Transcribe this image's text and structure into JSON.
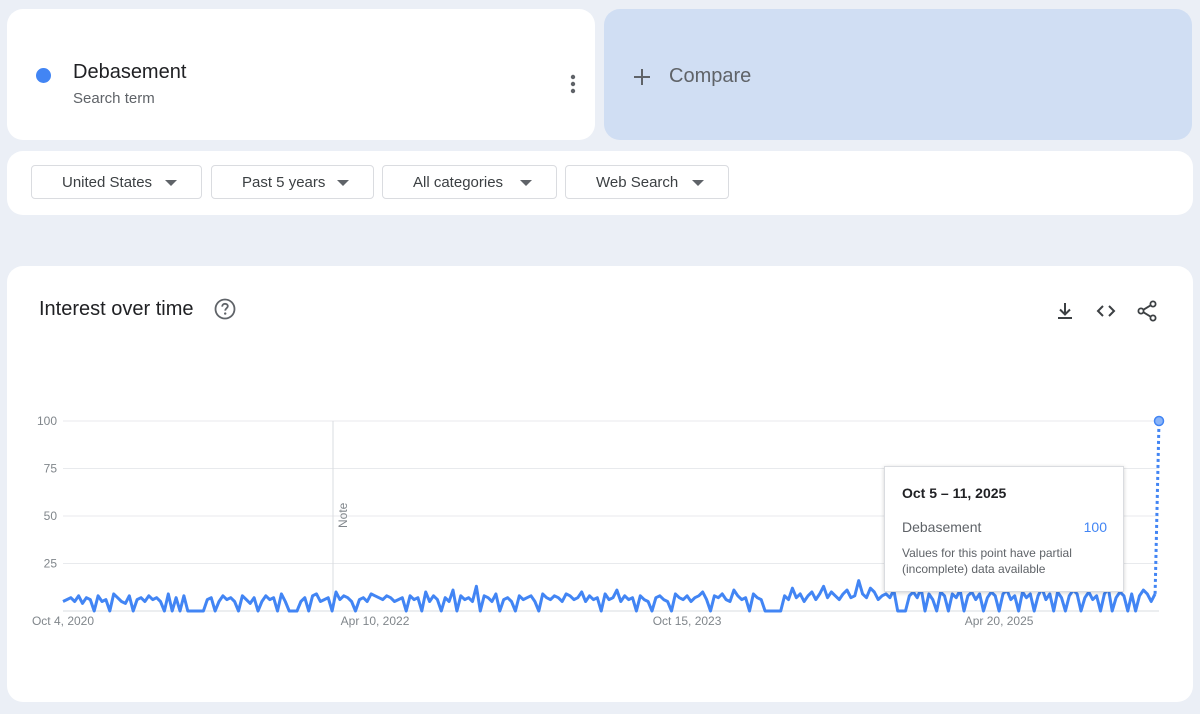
{
  "search_term": {
    "name": "Debasement",
    "subtitle": "Search term",
    "color": "#4285f4",
    "menu_icon": "more-vert-icon"
  },
  "compare": {
    "label": "Compare",
    "icon": "plus-icon"
  },
  "filters": [
    {
      "label": "United States"
    },
    {
      "label": "Past 5 years"
    },
    {
      "label": "All categories"
    },
    {
      "label": "Web Search"
    }
  ],
  "chart_panel": {
    "title": "Interest over time",
    "icons": [
      "help-icon",
      "download-icon",
      "embed-icon",
      "share-icon"
    ],
    "note_label": "Note"
  },
  "tooltip": {
    "date": "Oct 5 – 11, 2025",
    "term": "Debasement",
    "value": "100",
    "note": "Values for this point have partial (incomplete) data available"
  },
  "chart_data": {
    "type": "line",
    "title": "Interest over time",
    "xlabel": "",
    "ylabel": "",
    "ylim": [
      0,
      100
    ],
    "yticks": [
      25,
      50,
      75,
      100
    ],
    "grid": true,
    "xtick_labels": [
      "Oct 4, 2020",
      "Apr 10, 2022",
      "Oct 15, 2023",
      "Apr 20, 2025"
    ],
    "x_range": [
      "Oct 4, 2020",
      "Oct 5, 2025"
    ],
    "last_point_partial": true,
    "series": [
      {
        "name": "Debasement",
        "color": "#4285f4",
        "values": [
          5,
          6,
          7,
          5,
          8,
          4,
          7,
          6,
          0,
          8,
          5,
          6,
          0,
          9,
          7,
          5,
          4,
          8,
          0,
          6,
          7,
          5,
          8,
          6,
          7,
          5,
          0,
          9,
          0,
          7,
          0,
          8,
          0,
          0,
          0,
          0,
          0,
          6,
          7,
          0,
          5,
          8,
          6,
          7,
          5,
          0,
          8,
          6,
          4,
          7,
          0,
          5,
          8,
          6,
          7,
          0,
          9,
          5,
          0,
          0,
          0,
          5,
          7,
          0,
          8,
          9,
          5,
          6,
          7,
          0,
          10,
          6,
          8,
          7,
          5,
          0,
          6,
          7,
          5,
          9,
          8,
          7,
          6,
          8,
          7,
          5,
          6,
          7,
          0,
          8,
          6,
          7,
          0,
          10,
          5,
          8,
          6,
          0,
          7,
          5,
          11,
          0,
          8,
          6,
          7,
          5,
          13,
          0,
          8,
          7,
          5,
          9,
          0,
          6,
          7,
          5,
          0,
          8,
          6,
          7,
          8,
          5,
          0,
          9,
          7,
          6,
          8,
          7,
          5,
          9,
          8,
          6,
          7,
          10,
          5,
          8,
          6,
          7,
          0,
          9,
          6,
          7,
          11,
          5,
          8,
          6,
          7,
          0,
          8,
          6,
          5,
          0,
          7,
          8,
          6,
          5,
          0,
          9,
          7,
          6,
          8,
          5,
          7,
          8,
          10,
          6,
          0,
          8,
          7,
          9,
          6,
          5,
          11,
          8,
          6,
          7,
          0,
          9,
          7,
          6,
          0,
          0,
          0,
          0,
          0,
          8,
          6,
          12,
          7,
          9,
          5,
          8,
          10,
          6,
          9,
          13,
          7,
          10,
          8,
          6,
          9,
          11,
          7,
          8,
          16,
          9,
          7,
          12,
          10,
          6,
          8,
          9,
          7,
          11,
          0,
          0,
          0,
          8,
          10,
          7,
          12,
          0,
          9,
          6,
          0,
          10,
          8,
          0,
          9,
          7,
          11,
          0,
          8,
          10,
          6,
          9,
          0,
          7,
          10,
          8,
          0,
          9,
          11,
          6,
          8,
          0,
          10,
          7,
          9,
          0,
          8,
          12,
          6,
          9,
          0,
          10,
          7,
          0,
          8,
          11,
          9,
          0,
          7,
          10,
          6,
          8,
          0,
          9,
          12,
          0,
          7,
          10,
          8,
          0,
          9,
          0,
          8,
          11,
          9,
          5,
          9,
          100
        ]
      }
    ]
  }
}
